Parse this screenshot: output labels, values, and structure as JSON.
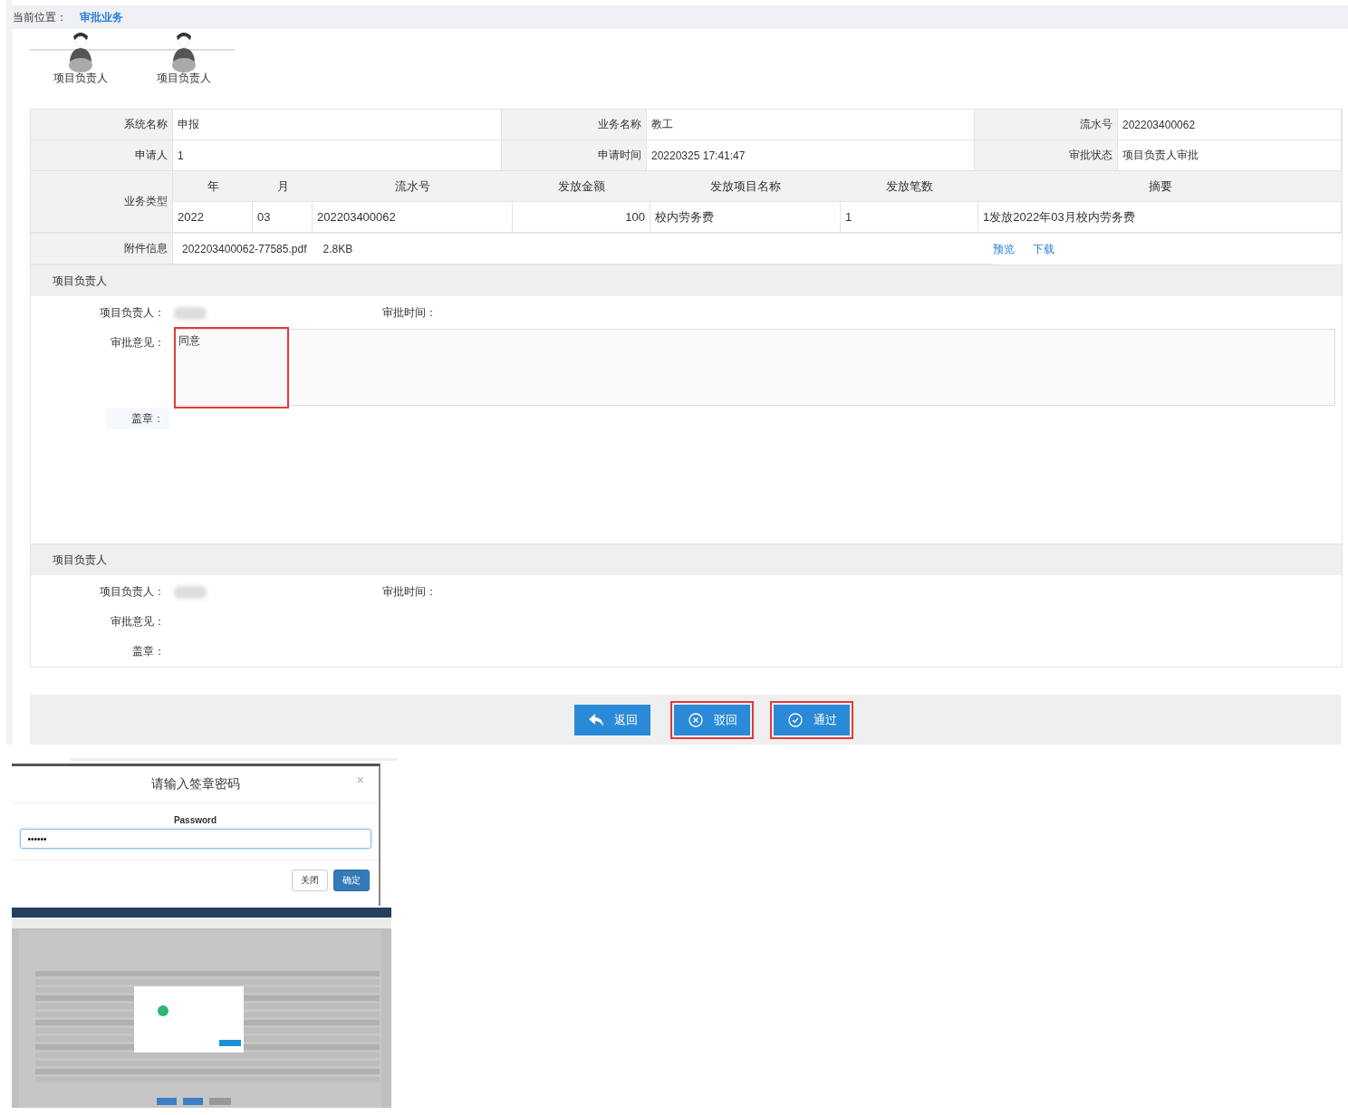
{
  "breadcrumb": {
    "label": "当前位置：",
    "current": "审批业务"
  },
  "flow": [
    {
      "label": "项目负责人"
    },
    {
      "label": "项目负责人"
    }
  ],
  "info_rows": [
    [
      {
        "label": "系统名称",
        "value": "申报"
      },
      {
        "label": "业务名称",
        "value": "教工"
      },
      {
        "label": "流水号",
        "value": "202203400062"
      }
    ],
    [
      {
        "label": "申请人",
        "value": "1"
      },
      {
        "label": "申请时间",
        "value": "20220325 17:41:47"
      },
      {
        "label": "审批状态",
        "value": "项目负责人审批"
      }
    ]
  ],
  "business_type": {
    "label": "业务类型",
    "columns": [
      "年",
      "月",
      "流水号",
      "发放金额",
      "发放项目名称",
      "发放笔数",
      "摘要"
    ],
    "row": [
      "2022",
      "03",
      "202203400062",
      "100",
      "校内劳务费",
      "1",
      "1发放2022年03月校内劳务费"
    ]
  },
  "attachment": {
    "label": "附件信息",
    "file": "202203400062-77585.pdf",
    "size": "2.8KB",
    "links": [
      "预览",
      "下载"
    ]
  },
  "approvals": [
    {
      "title": "项目负责人",
      "person_label": "项目负责人：",
      "time_label": "审批时间：",
      "opinion_label": "审批意见：",
      "opinion": "同意",
      "seal_label": "盖章：",
      "editable": true,
      "highlighted": true
    },
    {
      "title": "项目负责人",
      "person_label": "项目负责人：",
      "time_label": "审批时间：",
      "opinion_label": "审批意见：",
      "seal_label": "盖章：",
      "editable": false,
      "highlighted": false
    }
  ],
  "actions": [
    {
      "kind": "back",
      "label": "返回",
      "highlighted": false
    },
    {
      "kind": "reject",
      "label": "驳回",
      "highlighted": true
    },
    {
      "kind": "approve",
      "label": "通过",
      "highlighted": true
    }
  ],
  "dialog": {
    "title": "请输入签章密码",
    "close": "×",
    "field_label": "Password",
    "value": "••••••",
    "buttons": [
      {
        "label": "关闭",
        "primary": false
      },
      {
        "label": "确定",
        "primary": true
      }
    ]
  }
}
